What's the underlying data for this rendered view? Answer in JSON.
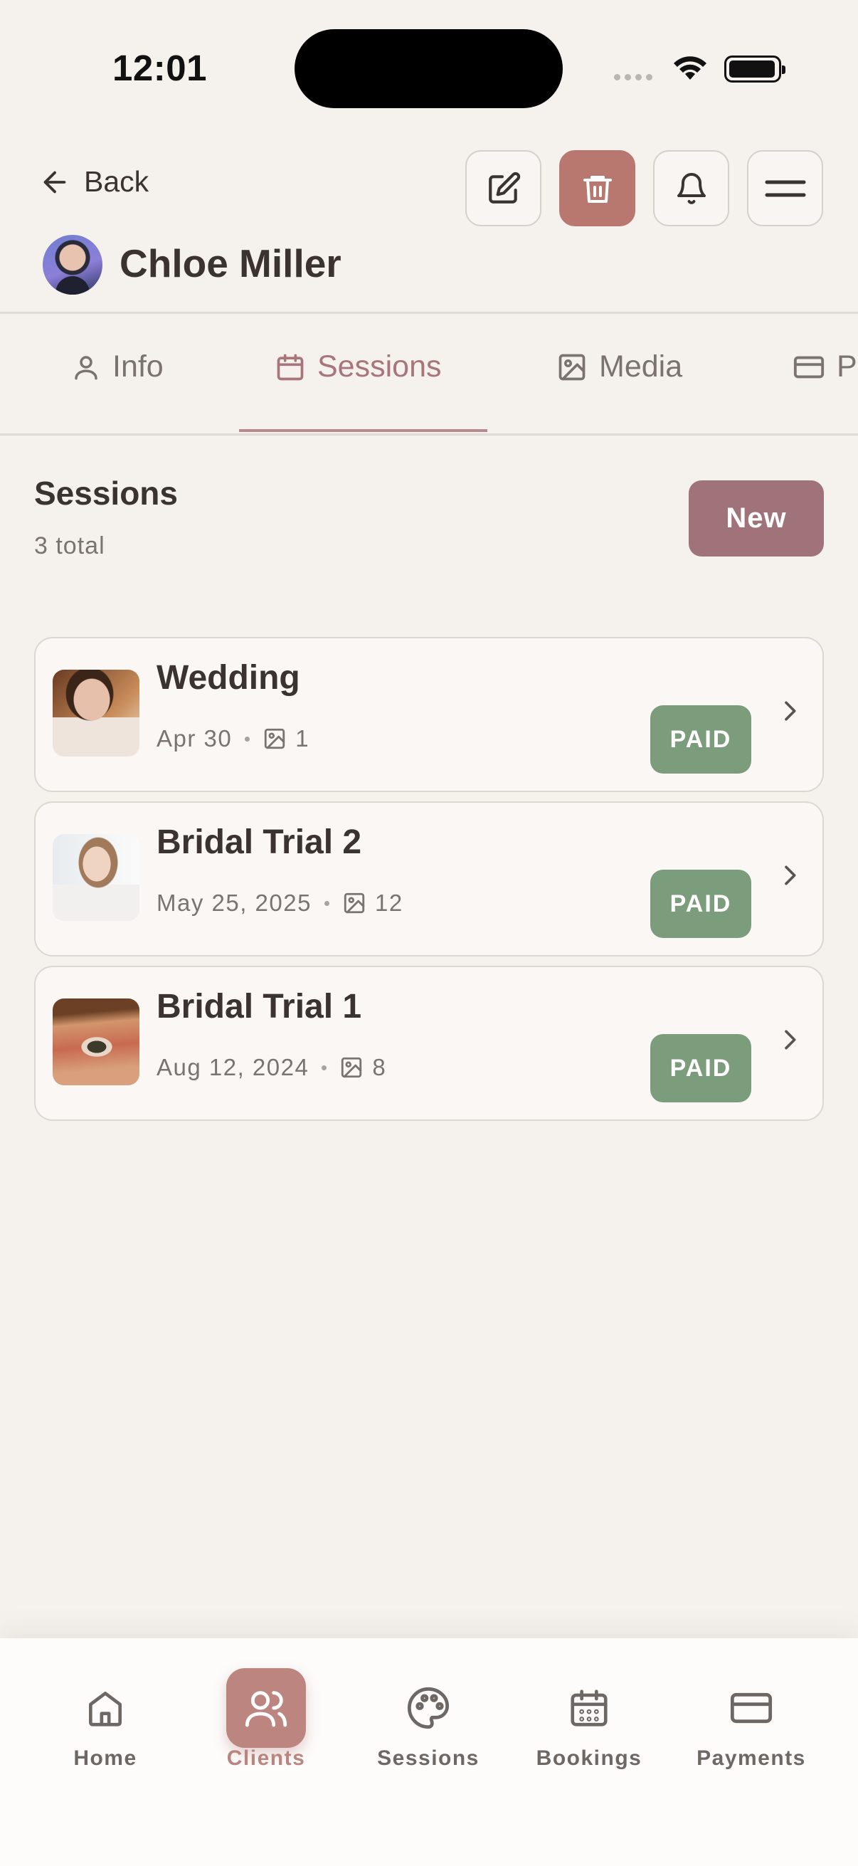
{
  "status_bar": {
    "time": "12:01"
  },
  "header": {
    "back_label": "Back",
    "client_name": "Chloe Miller",
    "actions": [
      "edit",
      "delete",
      "notifications",
      "menu"
    ]
  },
  "tabs": [
    {
      "label": "Info",
      "icon": "user-icon",
      "active": false
    },
    {
      "label": "Sessions",
      "icon": "calendar-icon",
      "active": true
    },
    {
      "label": "Media",
      "icon": "image-icon",
      "active": false
    },
    {
      "label": "Pa",
      "icon": "credit-card-icon",
      "active": false
    }
  ],
  "section": {
    "title": "Sessions",
    "subtitle": "3 total",
    "new_button": "New"
  },
  "sessions": [
    {
      "title": "Wedding",
      "date": "Apr 30",
      "photo_count": "1",
      "status": "PAID"
    },
    {
      "title": "Bridal Trial 2",
      "date": "May 25, 2025",
      "photo_count": "12",
      "status": "PAID"
    },
    {
      "title": "Bridal Trial 1",
      "date": "Aug 12, 2024",
      "photo_count": "8",
      "status": "PAID"
    }
  ],
  "bottom_nav": [
    {
      "label": "Home",
      "icon": "home-icon",
      "active": false
    },
    {
      "label": "Clients",
      "icon": "users-icon",
      "active": true
    },
    {
      "label": "Sessions",
      "icon": "palette-icon",
      "active": false
    },
    {
      "label": "Bookings",
      "icon": "calendar-grid-icon",
      "active": false
    },
    {
      "label": "Payments",
      "icon": "card-icon",
      "active": false
    }
  ],
  "colors": {
    "background": "#f5f1ed",
    "accent": "#a0727a",
    "danger": "#b87870",
    "paid": "#7c9d7b",
    "active_nav": "#bd8580"
  }
}
